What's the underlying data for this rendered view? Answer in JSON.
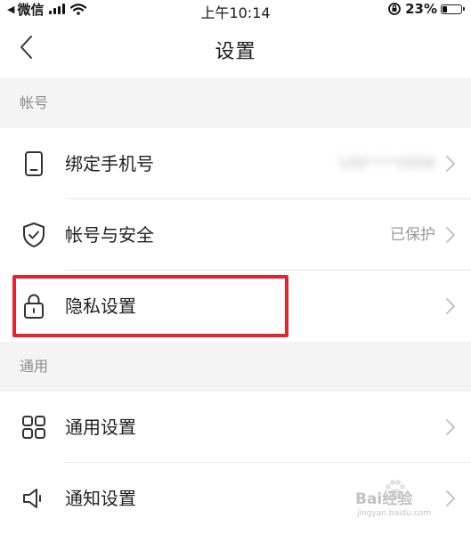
{
  "status_bar": {
    "carrier": "微信",
    "time": "上午10:14",
    "battery_percent": "23%",
    "battery_level": 0.23
  },
  "nav": {
    "title": "设置"
  },
  "sections": [
    {
      "header": "帐号",
      "rows": [
        {
          "label": "绑定手机号",
          "value": "188****0888",
          "icon": "phone-icon"
        },
        {
          "label": "帐号与安全",
          "value": "已保护",
          "icon": "shield-check-icon"
        },
        {
          "label": "隐私设置",
          "value": "",
          "icon": "lock-icon"
        }
      ]
    },
    {
      "header": "通用",
      "rows": [
        {
          "label": "通用设置",
          "value": "",
          "icon": "grid-icon"
        },
        {
          "label": "通知设置",
          "value": "",
          "icon": "speaker-icon"
        }
      ]
    }
  ],
  "watermark": {
    "logo": "Bai经验",
    "url": "jingyan.baidu.com"
  },
  "colors": {
    "highlight": "#e0262f",
    "section_bg": "#f4f4f4",
    "secondary_text": "#9a9a9a"
  }
}
